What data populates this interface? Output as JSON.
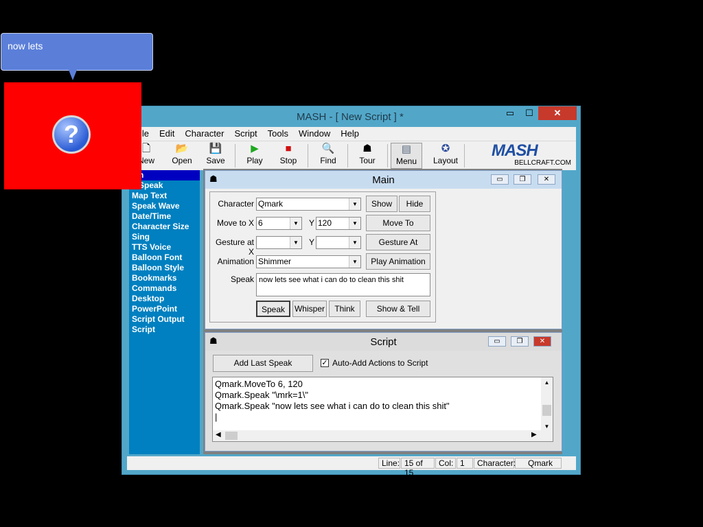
{
  "balloon": {
    "text": "now lets"
  },
  "window": {
    "title": "MASH - [ New Script ] *",
    "controls": {
      "minimize": "▭",
      "maximize": "☐",
      "close": "✕"
    }
  },
  "menu": [
    "File",
    "Edit",
    "Character",
    "Script",
    "Tools",
    "Window",
    "Help"
  ],
  "toolbar": {
    "buttons": [
      {
        "label": "New",
        "icon": "new-document-icon"
      },
      {
        "label": "Open",
        "icon": "folder-icon"
      },
      {
        "label": "Save",
        "icon": "floppy-icon"
      },
      {
        "label": "Play",
        "icon": "play-icon"
      },
      {
        "label": "Stop",
        "icon": "stop-icon"
      },
      {
        "label": "Find",
        "icon": "magnifier-icon"
      },
      {
        "label": "Tour",
        "icon": "character-icon"
      },
      {
        "label": "Menu",
        "icon": "menu-window-icon"
      },
      {
        "label": "Layout",
        "icon": "layout-icon"
      }
    ],
    "logo": {
      "text": "MASH",
      "sub": "BELLCRAFT.COM"
    }
  },
  "nav": {
    "items": [
      "Main",
      "Adv Speak",
      "Map Text",
      "Speak Wave",
      "Date/Time",
      "Character Size",
      "Sing",
      "TTS Voice",
      "Balloon Font",
      "Balloon Style",
      "Bookmarks",
      "Commands",
      "Desktop",
      "PowerPoint",
      "Script Output",
      "Script"
    ],
    "visible": [
      "ain",
      "v Speak",
      "Map Text",
      "Speak Wave",
      "Date/Time",
      "Character Size",
      "Sing",
      "TTS Voice",
      "Balloon Font",
      "Balloon Style",
      "Bookmarks",
      "Commands",
      "Desktop",
      "PowerPoint",
      "Script Output",
      "Script"
    ],
    "selected_index": 0
  },
  "main": {
    "title": "Main",
    "character_label": "Character",
    "character_value": "Qmark",
    "show_btn": "Show",
    "hide_btn": "Hide",
    "moveto_label": "Move to X",
    "moveto_x": "6",
    "y_label": "Y",
    "moveto_y": "120",
    "moveto_btn": "Move To",
    "gesture_label": "Gesture at X",
    "gesture_x": "",
    "gesture_y": "",
    "gesture_btn": "Gesture At",
    "animation_label": "Animation",
    "animation_value": "Shimmer",
    "play_anim_btn": "Play Animation",
    "speak_label": "Speak",
    "speak_text": "now lets see what i can do to clean this shit",
    "speak_btn": "Speak",
    "whisper_btn": "Whisper",
    "think_btn": "Think",
    "showtell_btn": "Show & Tell"
  },
  "script": {
    "title": "Script",
    "add_last_btn": "Add Last Speak",
    "auto_add_label": "Auto-Add Actions to Script",
    "auto_add_checked": true,
    "lines": [
      "Qmark.MoveTo 6, 120",
      "Qmark.Speak \"\\mrk=1\\\"",
      "Qmark.Speak \"now lets see what i can do to clean this shit\""
    ]
  },
  "status": {
    "line_label": "Line:",
    "line_value": "15 of 15",
    "col_label": "Col:",
    "col_value": "1",
    "char_label": "Character:",
    "char_value": "Qmark"
  },
  "agent": {
    "glyph": "?"
  }
}
